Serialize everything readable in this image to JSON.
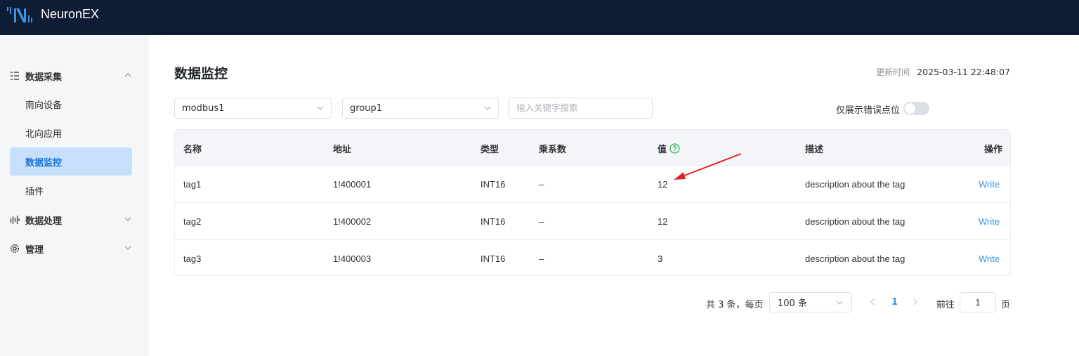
{
  "app": {
    "brand": "NeuronEX"
  },
  "sidebar": {
    "groups": [
      {
        "label": "数据采集",
        "icon": "data-collect-icon",
        "expanded": true
      },
      {
        "label": "数据处理",
        "icon": "data-process-icon",
        "expanded": false
      },
      {
        "label": "管理",
        "icon": "gear-icon",
        "expanded": false
      }
    ],
    "items": [
      {
        "label": "南向设备",
        "active": false
      },
      {
        "label": "北向应用",
        "active": false
      },
      {
        "label": "数据监控",
        "active": true
      },
      {
        "label": "插件",
        "active": false
      }
    ]
  },
  "main": {
    "title": "数据监控",
    "update_label": "更新时间",
    "update_value": "2025-03-11 22:48:07",
    "filters": {
      "node": "modbus1",
      "group": "group1",
      "search_placeholder": "输入关键字搜索",
      "error_only_label": "仅展示错误点位",
      "error_only": false
    },
    "table": {
      "columns": [
        "名称",
        "地址",
        "类型",
        "乘系数",
        "值",
        "描述",
        "操作"
      ],
      "rows": [
        {
          "name": "tag1",
          "address": "1!400001",
          "type": "INT16",
          "multiplier": "–",
          "value": "12",
          "description": "description about the tag",
          "action": "Write"
        },
        {
          "name": "tag2",
          "address": "1!400002",
          "type": "INT16",
          "multiplier": "–",
          "value": "12",
          "description": "description about the tag",
          "action": "Write"
        },
        {
          "name": "tag3",
          "address": "1!400003",
          "type": "INT16",
          "multiplier": "–",
          "value": "3",
          "description": "description about the tag",
          "action": "Write"
        }
      ]
    },
    "pagination": {
      "total_text": "共 3 条，每页",
      "page_size": "100 条",
      "current_page": "1",
      "goto_label": "前往",
      "goto_value": "1",
      "page_suffix": "页"
    }
  },
  "colors": {
    "header_bg": "#0e1c36",
    "accent": "#3a95e0",
    "active_menu_bg": "#c6e0fb",
    "help_icon": "#2bb35c",
    "annotation_arrow": "#e02424"
  }
}
